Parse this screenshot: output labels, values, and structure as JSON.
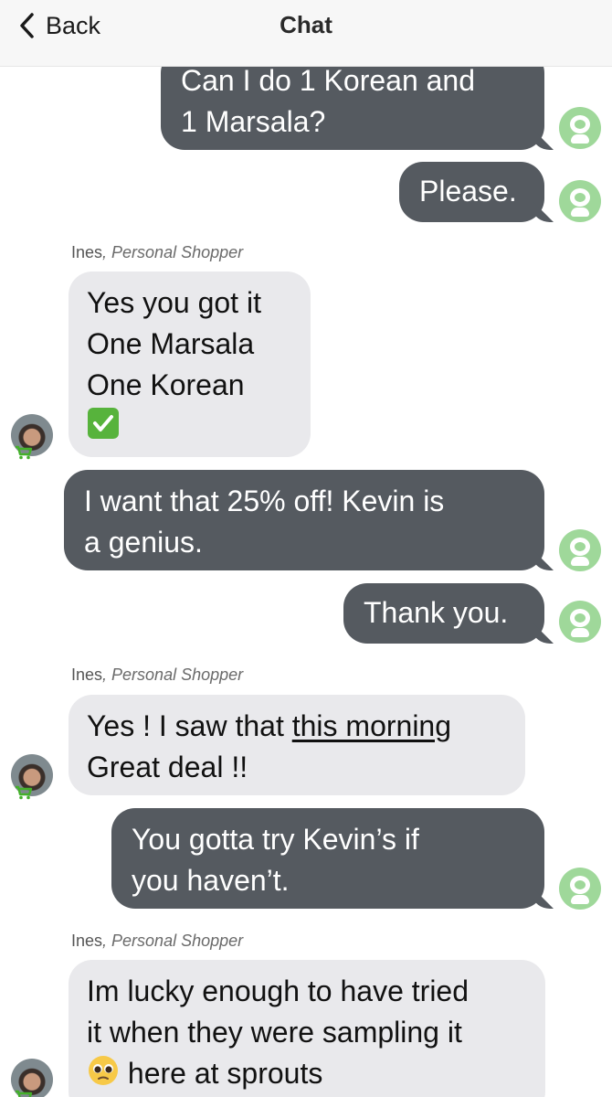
{
  "nav": {
    "back_label": "Back",
    "title": "Chat",
    "back_icon": "chevron-left-icon"
  },
  "colors": {
    "outgoing_bubble": "#555a60",
    "incoming_bubble": "#e9e9ec",
    "user_avatar": "#9fd89a",
    "cart_badge": "#43b02a"
  },
  "messages": [
    {
      "direction": "outgoing",
      "lines": [
        "Can I do 1 Korean and",
        "1 Marsala?"
      ]
    },
    {
      "direction": "outgoing",
      "lines": [
        "Please."
      ]
    },
    {
      "direction": "incoming",
      "sender_name": "Ines",
      "sender_role": ", Personal Shopper",
      "lines": [
        "Yes you got it",
        "One Marsala",
        "One Korean"
      ],
      "emoji": "✅"
    },
    {
      "direction": "outgoing",
      "lines": [
        "I want that 25% off! Kevin is",
        "a genius."
      ]
    },
    {
      "direction": "outgoing",
      "lines": [
        "Thank you."
      ]
    },
    {
      "direction": "incoming",
      "sender_name": "Ines",
      "sender_role": ", Personal Shopper",
      "line1_prefix": "Yes ! I saw that ",
      "line1_link": "this morning",
      "lines": [
        "Great deal !!"
      ]
    },
    {
      "direction": "outgoing",
      "lines": [
        "You gotta try Kevin’s if",
        "you haven’t."
      ]
    },
    {
      "direction": "incoming",
      "sender_name": "Ines",
      "sender_role": ", Personal Shopper",
      "lines": [
        "Im lucky enough to have tried",
        "it when they were sampling it"
      ],
      "line3_emoji": "🥺",
      "line3_text": " here at sprouts"
    }
  ]
}
